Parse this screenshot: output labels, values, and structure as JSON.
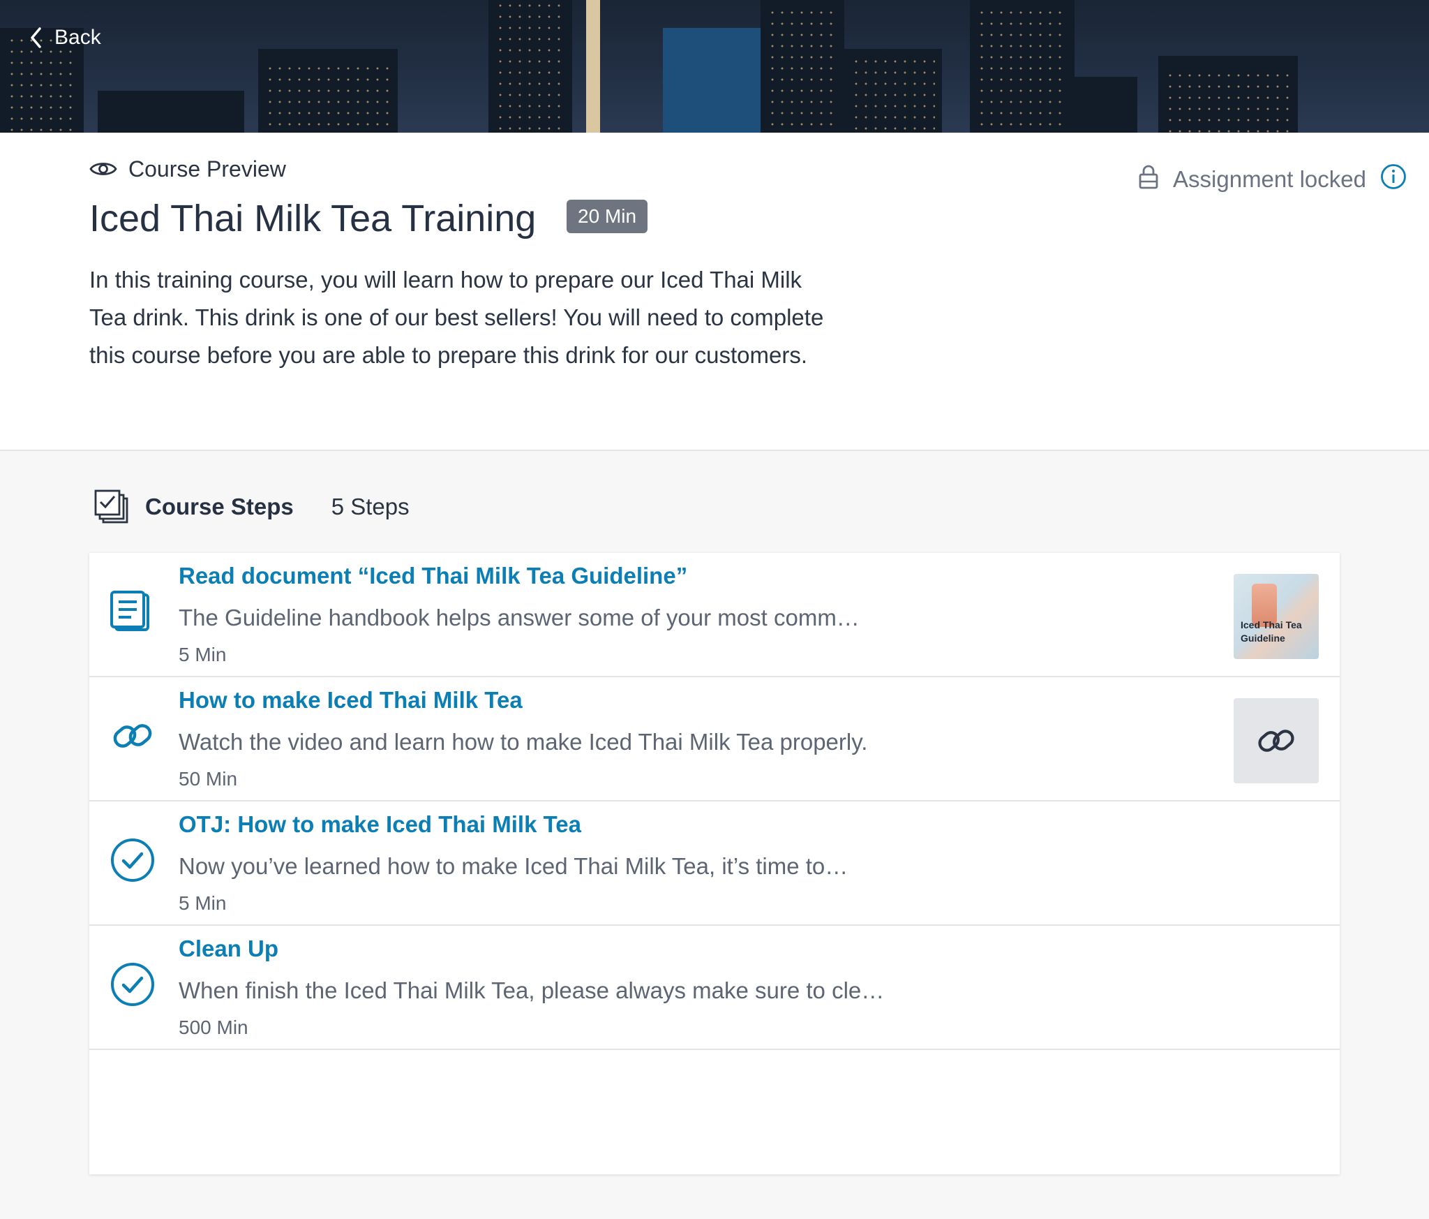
{
  "header": {
    "back_label": "Back"
  },
  "course": {
    "preview_label": "Course Preview",
    "title": "Iced Thai Milk Tea Training",
    "duration_badge": "20 Min",
    "description": "In this training course, you will learn how to prepare our Iced Thai Milk Tea drink. This drink is one of our best sellers! You will need to complete this course before you are able to prepare this drink for our customers.",
    "assignment_status": "Assignment locked"
  },
  "steps_section": {
    "title": "Course Steps",
    "count": "5 Steps",
    "items": [
      {
        "icon": "document-icon",
        "title": "Read document “Iced Thai Milk Tea Guideline”",
        "description": "The Guideline handbook helps answer some of your most comm…",
        "duration": "5 Min",
        "thumbnail_label": "Iced Thai Tea Guideline"
      },
      {
        "icon": "link-icon",
        "title": "How to make Iced Thai Milk Tea",
        "description": "Watch the video and learn how to make Iced Thai Milk Tea properly.",
        "duration": "50 Min"
      },
      {
        "icon": "check-circle-icon",
        "title": "OTJ: How to make Iced Thai Milk Tea",
        "description": "Now you’ve learned how to make Iced Thai Milk Tea, it’s time to…",
        "duration": "5 Min"
      },
      {
        "icon": "check-circle-icon",
        "title": "Clean Up",
        "description": "When finish the Iced Thai Milk Tea, please always make sure to cle…",
        "duration": "500 Min"
      }
    ]
  },
  "colors": {
    "accent": "#0b7fb5",
    "badge": "#6e7480",
    "text": "#2b3442",
    "muted": "#5d6573"
  }
}
